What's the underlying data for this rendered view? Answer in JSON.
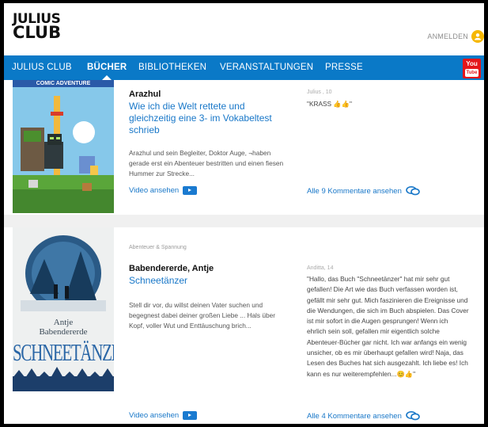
{
  "header": {
    "logo_line1": "JULIUS",
    "logo_line2": "CLUB",
    "login_label": "ANMELDEN"
  },
  "nav": {
    "items": [
      {
        "label": "JULIUS CLUB"
      },
      {
        "label": "BÜCHER"
      },
      {
        "label": "BIBLIOTHEKEN"
      },
      {
        "label": "VERANSTALTUNGEN"
      },
      {
        "label": "PRESSE"
      }
    ],
    "active_index": 1,
    "youtube_label_top": "You",
    "youtube_label_bottom": "Tube"
  },
  "books": [
    {
      "cover_banner": "COMIC ADVENTURE",
      "author": "Arazhul",
      "title": "Wie ich die Welt rettete und gleichzeitig eine 3- im Vokabeltest schrieb",
      "description": "Arazhul und sein Begleiter, Doktor Auge, ¬haben gerade erst ein Abenteuer bestritten und einen fiesen Hummer zur Strecke...",
      "video_label": "Video ansehen",
      "comment_meta": "Julius , 10",
      "comment_text": "\"KRASS 👍👍\"",
      "comments_link": "Alle 9 Kommentare ansehen"
    },
    {
      "category": "Abenteuer & Spannung",
      "cover_author_line1": "Antje",
      "cover_author_line2": "Babendererde",
      "cover_title": "SCHNEETÄNZER",
      "author": "Babendererde, Antje",
      "title": "Schneetänzer",
      "description": "Stell dir vor, du willst deinen Vater suchen und begegnest dabei deiner großen Liebe ... Hals über Kopf, voller Wut und Enttäuschung brich...",
      "video_label": "Video ansehen",
      "comment_meta": "Anditta, 14",
      "comment_text": "\"Hallo, das Buch \"Schneetänzer\" hat mir sehr gut gefallen! Die Art wie das Buch verfassen worden ist, gefällt mir sehr gut. Mich faszinieren die Ereignisse und die Wendungen, die sich im Buch abspielen. Das Cover ist mir sofort in die Augen gesprungen! Wenn ich ehrlich sein soll, gefallen mir eigentlich solche Abenteuer-Bücher gar nicht. Ich war anfangs ein wenig unsicher, ob es mir überhaupt gefallen wird! Naja, das Lesen des Buches hat sich ausgezahlt. Ich liebe es! Ich kann es nur weiterempfehlen...😊👍\"",
      "comments_link": "Alle 4 Kommentare ansehen"
    }
  ],
  "colors": {
    "nav_bg": "#0a79c7",
    "link": "#1877c8",
    "youtube": "#e4161b",
    "login_icon": "#f6b700"
  }
}
